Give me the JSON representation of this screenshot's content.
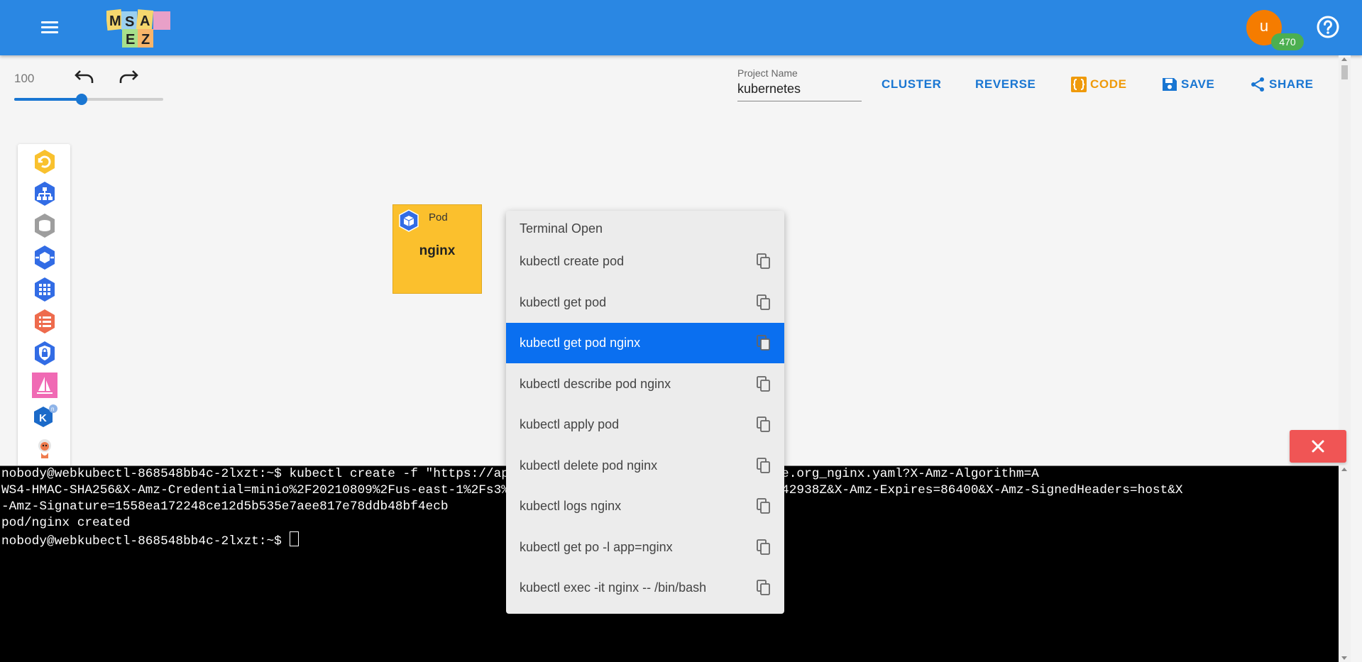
{
  "header": {
    "logo_letters": [
      "M",
      "S",
      "A",
      "E",
      "Z"
    ],
    "avatar_letter": "u",
    "points_badge": "470",
    "colors": {
      "appbar": "#2a87e3",
      "avatar": "#f57c00",
      "badge": "#4caf50"
    }
  },
  "toolbar": {
    "zoom_value": "100",
    "zoom_level": 0.45,
    "project_label": "Project Name",
    "project_value": "kubernetes",
    "cluster_label": "CLUSTER",
    "reverse_label": "REVERSE",
    "code_label": "CODE",
    "save_label": "SAVE",
    "share_label": "SHARE"
  },
  "palette": {
    "items": [
      "refresh-icon",
      "service-icon",
      "volume-icon",
      "deployment-icon",
      "replicaset-icon",
      "configmap-icon",
      "secret-icon",
      "helm-sail-icon",
      "knative-icon",
      "argo-icon"
    ]
  },
  "canvas": {
    "pod": {
      "type": "Pod",
      "name": "nginx",
      "color": "#fbc02d"
    }
  },
  "context_menu": {
    "title": "Terminal Open",
    "items": [
      {
        "label": "kubectl create pod"
      },
      {
        "label": "kubectl get pod"
      },
      {
        "label": "kubectl get pod nginx"
      },
      {
        "label": "kubectl describe pod nginx"
      },
      {
        "label": "kubectl apply pod"
      },
      {
        "label": "kubectl delete pod nginx"
      },
      {
        "label": "kubectl logs nginx"
      },
      {
        "label": "kubectl get po -l app=nginx"
      },
      {
        "label": "kubectl exec -it nginx -- /bin/bash"
      }
    ],
    "active_color": "#0a6ff0"
  },
  "terminal": {
    "line1": "nobody@webkubectl-868548bb4c-2lxzt:~$ kubectl create -f \"https://api.msaez.io/yamlStorage/help%40uengine.org_nginx.yaml?X-Amz-Algorithm=A",
    "line2": "WS4-HMAC-SHA256&X-Amz-Credential=minio%2F20210809%2Fus-east-1%2Fs3%2Faws4_request&X-Amz-Date=20210809T042938Z&X-Amz-Expires=86400&X-Amz-SignedHeaders=host&X",
    "line3": "-Amz-Signature=1558ea172248ce12d5b535e7aee817e78ddb48bf4ecb",
    "line4": "pod/nginx created",
    "line5": "nobody@webkubectl-868548bb4c-2lxzt:~$ "
  }
}
